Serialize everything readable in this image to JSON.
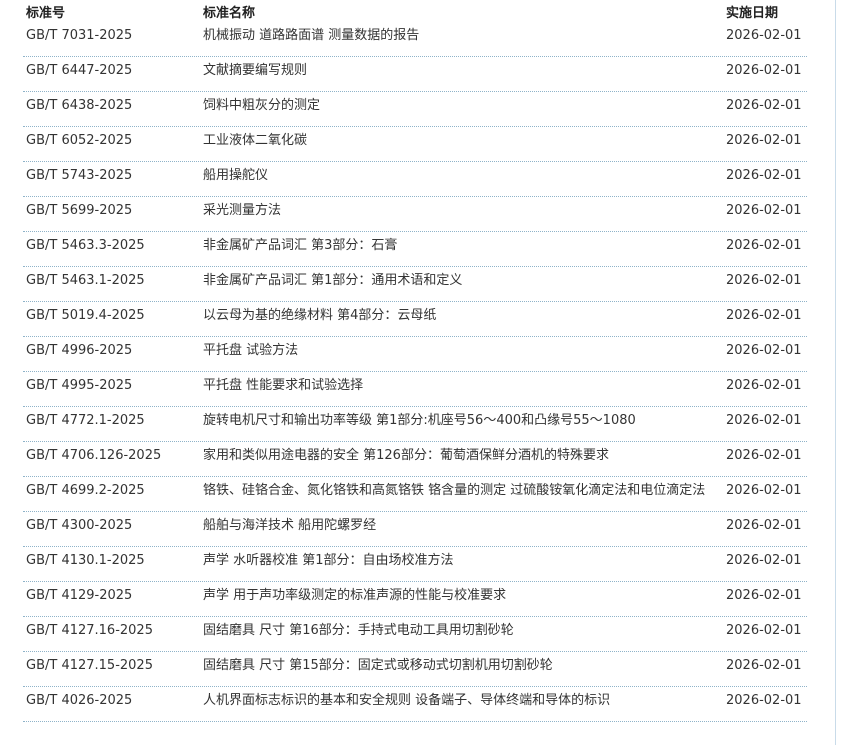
{
  "table": {
    "headers": {
      "code": "标准号",
      "name": "标准名称",
      "date": "实施日期"
    },
    "rows": [
      {
        "code": "GB/T 7031-2025",
        "name": "机械振动 道路路面谱 测量数据的报告",
        "date": "2026-02-01"
      },
      {
        "code": "GB/T 6447-2025",
        "name": "文献摘要编写规则",
        "date": "2026-02-01"
      },
      {
        "code": "GB/T 6438-2025",
        "name": "饲料中粗灰分的测定",
        "date": "2026-02-01"
      },
      {
        "code": "GB/T 6052-2025",
        "name": "工业液体二氧化碳",
        "date": "2026-02-01"
      },
      {
        "code": "GB/T 5743-2025",
        "name": "船用操舵仪",
        "date": "2026-02-01"
      },
      {
        "code": "GB/T 5699-2025",
        "name": "采光测量方法",
        "date": "2026-02-01"
      },
      {
        "code": "GB/T 5463.3-2025",
        "name": "非金属矿产品词汇 第3部分：石膏",
        "date": "2026-02-01"
      },
      {
        "code": "GB/T 5463.1-2025",
        "name": "非金属矿产品词汇 第1部分：通用术语和定义",
        "date": "2026-02-01"
      },
      {
        "code": "GB/T 5019.4-2025",
        "name": "以云母为基的绝缘材料 第4部分：云母纸",
        "date": "2026-02-01"
      },
      {
        "code": "GB/T 4996-2025",
        "name": "平托盘 试验方法",
        "date": "2026-02-01"
      },
      {
        "code": "GB/T 4995-2025",
        "name": "平托盘 性能要求和试验选择",
        "date": "2026-02-01"
      },
      {
        "code": "GB/T 4772.1-2025",
        "name": "旋转电机尺寸和输出功率等级 第1部分:机座号56～400和凸缘号55～1080",
        "date": "2026-02-01"
      },
      {
        "code": "GB/T 4706.126-2025",
        "name": "家用和类似用途电器的安全 第126部分：葡萄酒保鲜分酒机的特殊要求",
        "date": "2026-02-01"
      },
      {
        "code": "GB/T 4699.2-2025",
        "name": "铬铁、硅铬合金、氮化铬铁和高氮铬铁 铬含量的测定 过硫酸铵氧化滴定法和电位滴定法",
        "date": "2026-02-01"
      },
      {
        "code": "GB/T 4300-2025",
        "name": "船舶与海洋技术 船用陀螺罗经",
        "date": "2026-02-01"
      },
      {
        "code": "GB/T 4130.1-2025",
        "name": "声学 水听器校准 第1部分：自由场校准方法",
        "date": "2026-02-01"
      },
      {
        "code": "GB/T 4129-2025",
        "name": "声学 用于声功率级测定的标准声源的性能与校准要求",
        "date": "2026-02-01"
      },
      {
        "code": "GB/T 4127.16-2025",
        "name": "固结磨具 尺寸 第16部分：手持式电动工具用切割砂轮",
        "date": "2026-02-01"
      },
      {
        "code": "GB/T 4127.15-2025",
        "name": "固结磨具 尺寸 第15部分：固定式或移动式切割机用切割砂轮",
        "date": "2026-02-01"
      },
      {
        "code": "GB/T 4026-2025",
        "name": "人机界面标志标识的基本和安全规则 设备端子、导体终端和导体的标识",
        "date": "2026-02-01"
      }
    ]
  }
}
